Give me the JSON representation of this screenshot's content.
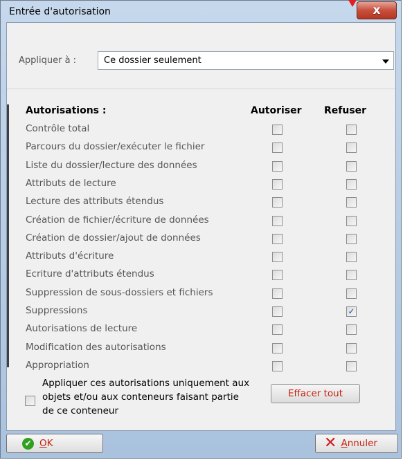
{
  "window": {
    "title": "Entrée d'autorisation",
    "close_glyph": "x"
  },
  "apply_to": {
    "label": "Appliquer à :",
    "value": "Ce dossier seulement"
  },
  "permissions": {
    "header_label": "Autorisations :",
    "allow_header": "Autoriser",
    "deny_header": "Refuser",
    "rows": [
      {
        "label": "Contrôle total",
        "allow": false,
        "deny": false
      },
      {
        "label": "Parcours du dossier/exécuter le fichier",
        "allow": false,
        "deny": false
      },
      {
        "label": "Liste du dossier/lecture des données",
        "allow": false,
        "deny": false
      },
      {
        "label": "Attributs de lecture",
        "allow": false,
        "deny": false
      },
      {
        "label": "Lecture des attributs étendus",
        "allow": false,
        "deny": false
      },
      {
        "label": "Création de fichier/écriture de données",
        "allow": false,
        "deny": false
      },
      {
        "label": "Création de dossier/ajout de données",
        "allow": false,
        "deny": false
      },
      {
        "label": "Attributs d'écriture",
        "allow": false,
        "deny": false
      },
      {
        "label": "Ecriture d'attributs étendus",
        "allow": false,
        "deny": false
      },
      {
        "label": "Suppression de sous-dossiers et fichiers",
        "allow": false,
        "deny": false
      },
      {
        "label": "Suppressions",
        "allow": false,
        "deny": true
      },
      {
        "label": "Autorisations de lecture",
        "allow": false,
        "deny": false
      },
      {
        "label": "Modification des autorisations",
        "allow": false,
        "deny": false
      },
      {
        "label": "Appropriation",
        "allow": false,
        "deny": false
      }
    ]
  },
  "apply_only": {
    "label": "Appliquer ces autorisations uniquement aux objets et/ou aux conteneurs faisant partie de ce conteneur",
    "checked": false
  },
  "buttons": {
    "clear_all": "Effacer tout",
    "ok_first": "O",
    "ok_rest": "K",
    "cancel_first": "A",
    "cancel_rest": "nnuler"
  },
  "icons": {
    "ok": "check-circle-icon",
    "cancel": "x-icon",
    "close": "close-icon"
  },
  "colors": {
    "accent_text": "#c8210f",
    "check_color": "#1f4fae",
    "ok_icon": "#2fa01f",
    "cancel_icon": "#d11a1a"
  }
}
